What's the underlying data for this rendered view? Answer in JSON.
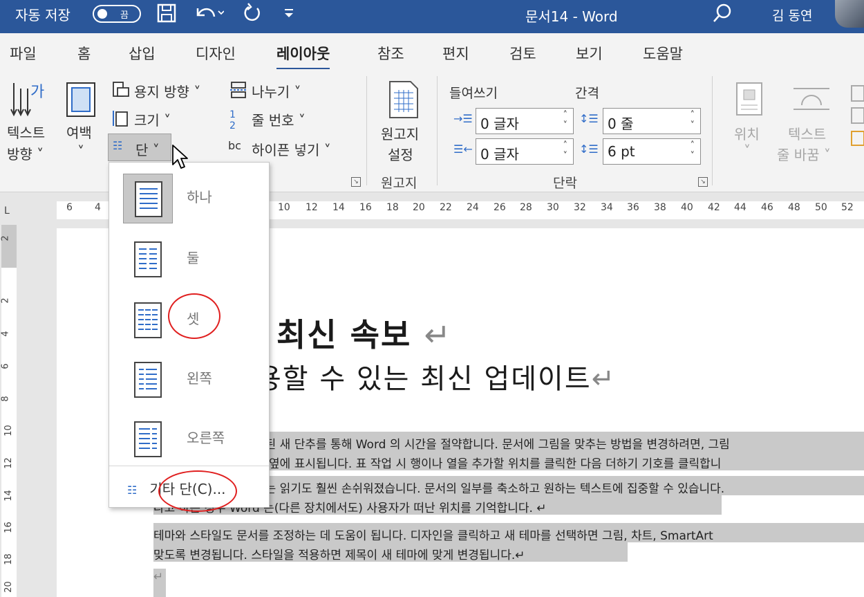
{
  "titlebar": {
    "autosave": "자동 저장",
    "toggle": "끔",
    "doc_title": "문서14  -  Word",
    "user": "김 동연"
  },
  "tabs": [
    "파일",
    "홈",
    "삽입",
    "디자인",
    "레이아웃",
    "참조",
    "편지",
    "검토",
    "보기",
    "도움말"
  ],
  "active_tab": "레이아웃",
  "ribbon": {
    "text_direction": [
      "텍스트",
      "방향 ˅"
    ],
    "margins": [
      "여백",
      "˅"
    ],
    "orientation": "용지 방향 ˅",
    "size": "크기 ˅",
    "columns": "단 ˅",
    "breaks": "나누기 ˅",
    "line_numbers": "줄 번호 ˅",
    "hyphenation": "하이픈 넣기 ˅",
    "manuscript": [
      "원고지",
      "설정"
    ],
    "manuscript_group": "원고지",
    "indent_label": "들여쓰기",
    "spacing_label": "간격",
    "indent_left": "0 글자",
    "indent_right": "0 글자",
    "spacing_before": "0 줄",
    "spacing_after": "6 pt",
    "paragraph_group": "단락",
    "position": [
      "위치",
      "˅"
    ],
    "wrap_text": [
      "텍스트",
      "줄 바꿈 ˅"
    ]
  },
  "ruler": {
    "corner": "L",
    "numbers": [
      "6",
      "4",
      "10",
      "12",
      "14",
      "16",
      "18",
      "20",
      "22",
      "24",
      "26",
      "28",
      "30",
      "32",
      "34",
      "36",
      "38",
      "40",
      "42",
      "44",
      "46",
      "48",
      "50",
      "52"
    ],
    "vertical": [
      "2",
      "2",
      "4",
      "6",
      "8",
      "10",
      "12",
      "14",
      "16",
      "18",
      "20"
    ]
  },
  "dropdown": {
    "items": [
      "하나",
      "둘",
      "셋",
      "왼쪽",
      "오른쪽"
    ],
    "more": "기타 단(C)..."
  },
  "document": {
    "heading1": "최신 속보",
    "heading2": "용할 수 있는 최신 업데이트",
    "para_mark": "↵",
    "lines": [
      "게된 새 단추를 통해 Word 의 시간을 절약합니다. 문서에 그림을 맞추는 방법을 변경하려면, 그림",
      "과 옆에 표시됩니다. 표 작업 시 행이나 열을 추가할 위치를 클릭한 다음 더하기 기호를 클릭합니",
      "서는 읽기도 훨씬 손쉬워졌습니다. 문서의 일부를 축소하고 원하는 텍스트에 집중할 수 있습니다.",
      "라고 하는 경우 Word 는(다른 장치에서도) 사용자가 떠난 위치를 기억합니다. ↵",
      "테마와 스타일도 문서를 조정하는 데 도움이 됩니다. 디자인을 클릭하고 새 테마를 선택하면 그림, 차트, SmartArt",
      "맞도록 변경됩니다. 스타일을 적용하면 제목이 새 테마에 맞게 변경됩니다.↵",
      "↵"
    ]
  }
}
